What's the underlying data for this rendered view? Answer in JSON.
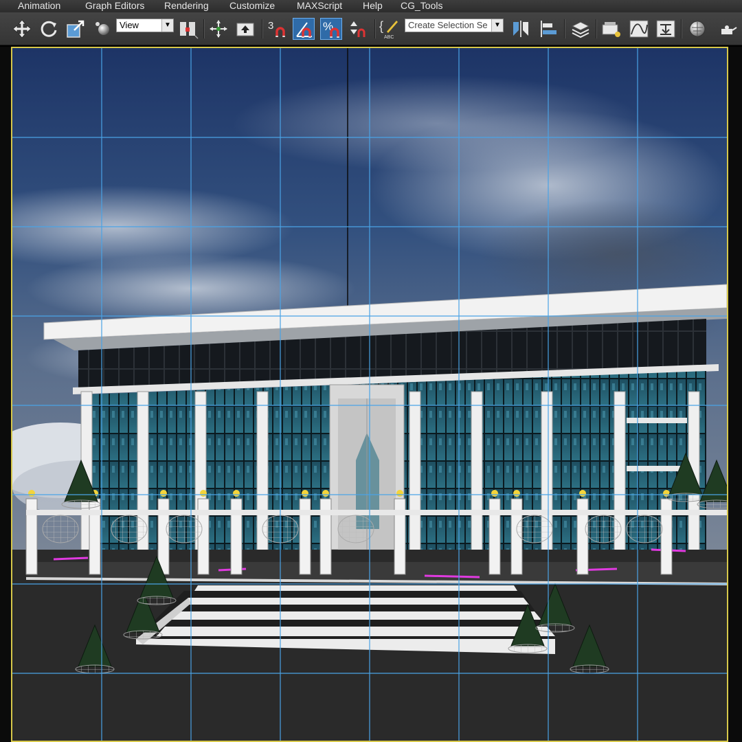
{
  "menu": {
    "items": [
      {
        "label": "Animation"
      },
      {
        "label": "Graph Editors"
      },
      {
        "label": "Rendering"
      },
      {
        "label": "Customize"
      },
      {
        "label": "MAXScript"
      },
      {
        "label": "Help"
      },
      {
        "label": "CG_Tools"
      }
    ]
  },
  "toolbar": {
    "reference_coord": "View",
    "angle_snap_digit": "3",
    "named_selection_placeholder": "Create Selection Se",
    "edit_named_sel_caption": "ABC",
    "active_tools": [
      "angle-snap",
      "percent-snap"
    ]
  },
  "viewport": {
    "active_border_color": "#d7c84a",
    "grid_color": "#4aa3e6"
  },
  "colors": {
    "sky_top": "#1d3466",
    "ground": "#2a2a2a",
    "accent_blue": "#2f6ba8"
  }
}
